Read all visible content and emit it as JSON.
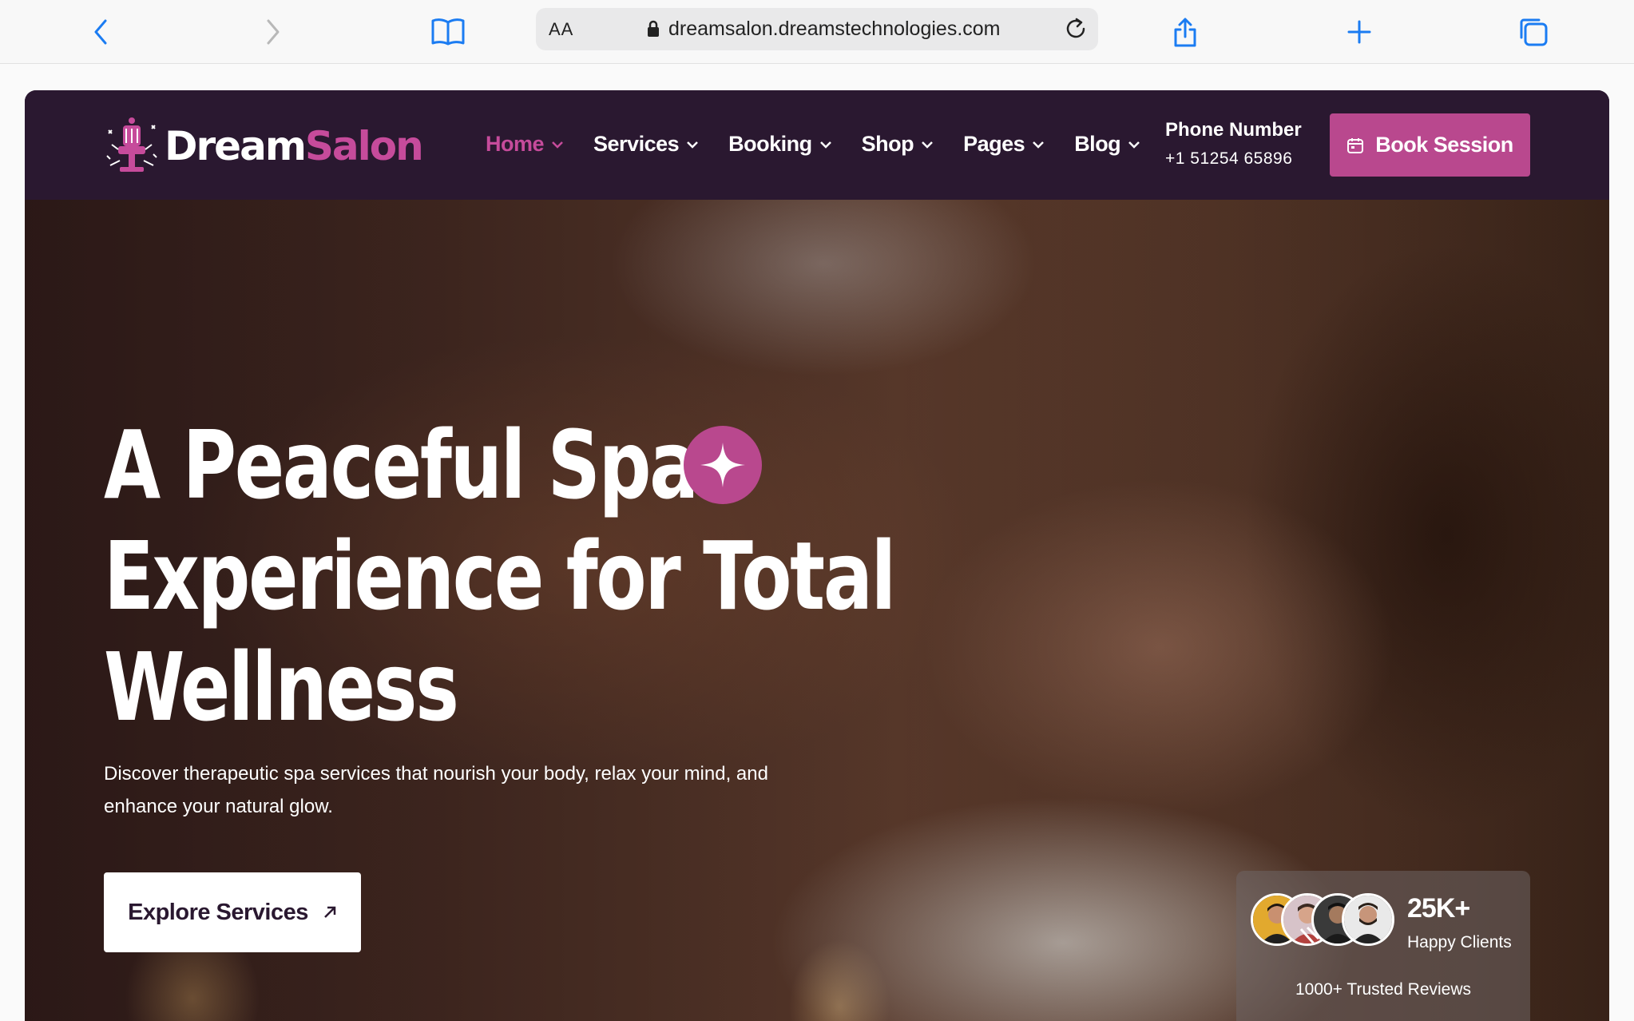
{
  "browser": {
    "aa_label": "AA",
    "url": "dreamsalon.dreamstechnologies.com"
  },
  "brand": {
    "name_part1": "Dream",
    "name_part2": "Salon",
    "accent_color": "#c64b9b"
  },
  "nav": {
    "items": [
      {
        "label": "Home",
        "active": true
      },
      {
        "label": "Services",
        "active": false
      },
      {
        "label": "Booking",
        "active": false
      },
      {
        "label": "Shop",
        "active": false
      },
      {
        "label": "Pages",
        "active": false
      },
      {
        "label": "Blog",
        "active": false
      }
    ],
    "phone_label": "Phone Number",
    "phone_number": "+1 51254 65896",
    "cta_label": "Book Session"
  },
  "hero": {
    "headline_lines": [
      "A Peaceful Spa",
      "Experience for Total",
      "Wellness"
    ],
    "subtext": "Discover therapeutic spa services that nourish your body, relax your mind, and enhance your natural glow.",
    "cta_label": "Explore Services",
    "stats": {
      "count": "25K+",
      "count_label": "Happy Clients",
      "reviews": "1000+ Trusted Reviews"
    }
  }
}
